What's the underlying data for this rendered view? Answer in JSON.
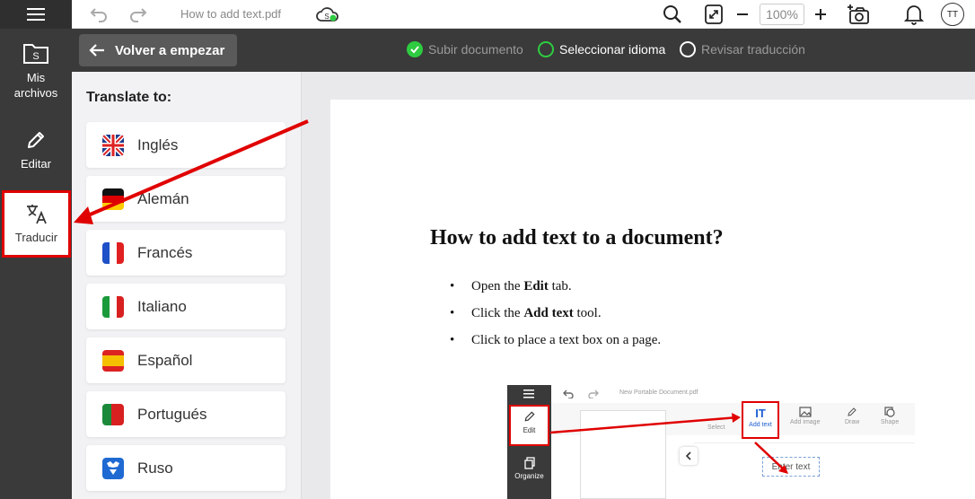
{
  "sidebar": {
    "menu_icon": "hamburger-icon",
    "items": [
      {
        "label": "Mis archivos",
        "icon": "folder-icon"
      },
      {
        "label": "Editar",
        "icon": "pencil-icon"
      },
      {
        "label": "Traducir",
        "icon": "translate-icon"
      }
    ]
  },
  "toolbar": {
    "filename": "How to add text.pdf",
    "zoom": "100%"
  },
  "stepbar": {
    "back_label": "Volver a empezar",
    "steps": [
      {
        "label": "Subir documento",
        "state": "done"
      },
      {
        "label": "Seleccionar idioma",
        "state": "current"
      },
      {
        "label": "Revisar traducción",
        "state": "pending"
      }
    ]
  },
  "langpanel": {
    "title": "Translate to:",
    "languages": [
      {
        "label": "Inglés",
        "flag": "uk-flag-icon"
      },
      {
        "label": "Alemán",
        "flag": "germany-flag-icon"
      },
      {
        "label": "Francés",
        "flag": "france-flag-icon"
      },
      {
        "label": "Italiano",
        "flag": "italy-flag-icon"
      },
      {
        "label": "Español",
        "flag": "spain-flag-icon"
      },
      {
        "label": "Portugués",
        "flag": "portugal-flag-icon"
      },
      {
        "label": "Ruso",
        "flag": "russia-flag-icon"
      }
    ]
  },
  "document": {
    "title": "How to add text to a document?",
    "steps": [
      {
        "pre": "Open the ",
        "bold": "Edit",
        "post": " tab."
      },
      {
        "pre": "Click the ",
        "bold": "Add text",
        "post": " tool."
      },
      {
        "pre": "Click to place a text box on a page.",
        "bold": "",
        "post": ""
      }
    ],
    "embed": {
      "filename": "New Portable Document.pdf",
      "edit_label": "Edit",
      "organize_label": "Organize",
      "tools": [
        "Select",
        "Add text",
        "Add image",
        "Draw",
        "Shape"
      ],
      "enter_text": "Enter text"
    }
  },
  "colors": {
    "accent_red": "#e00000",
    "done_green": "#2ecc40",
    "dark_bar": "#3a3a3a"
  }
}
